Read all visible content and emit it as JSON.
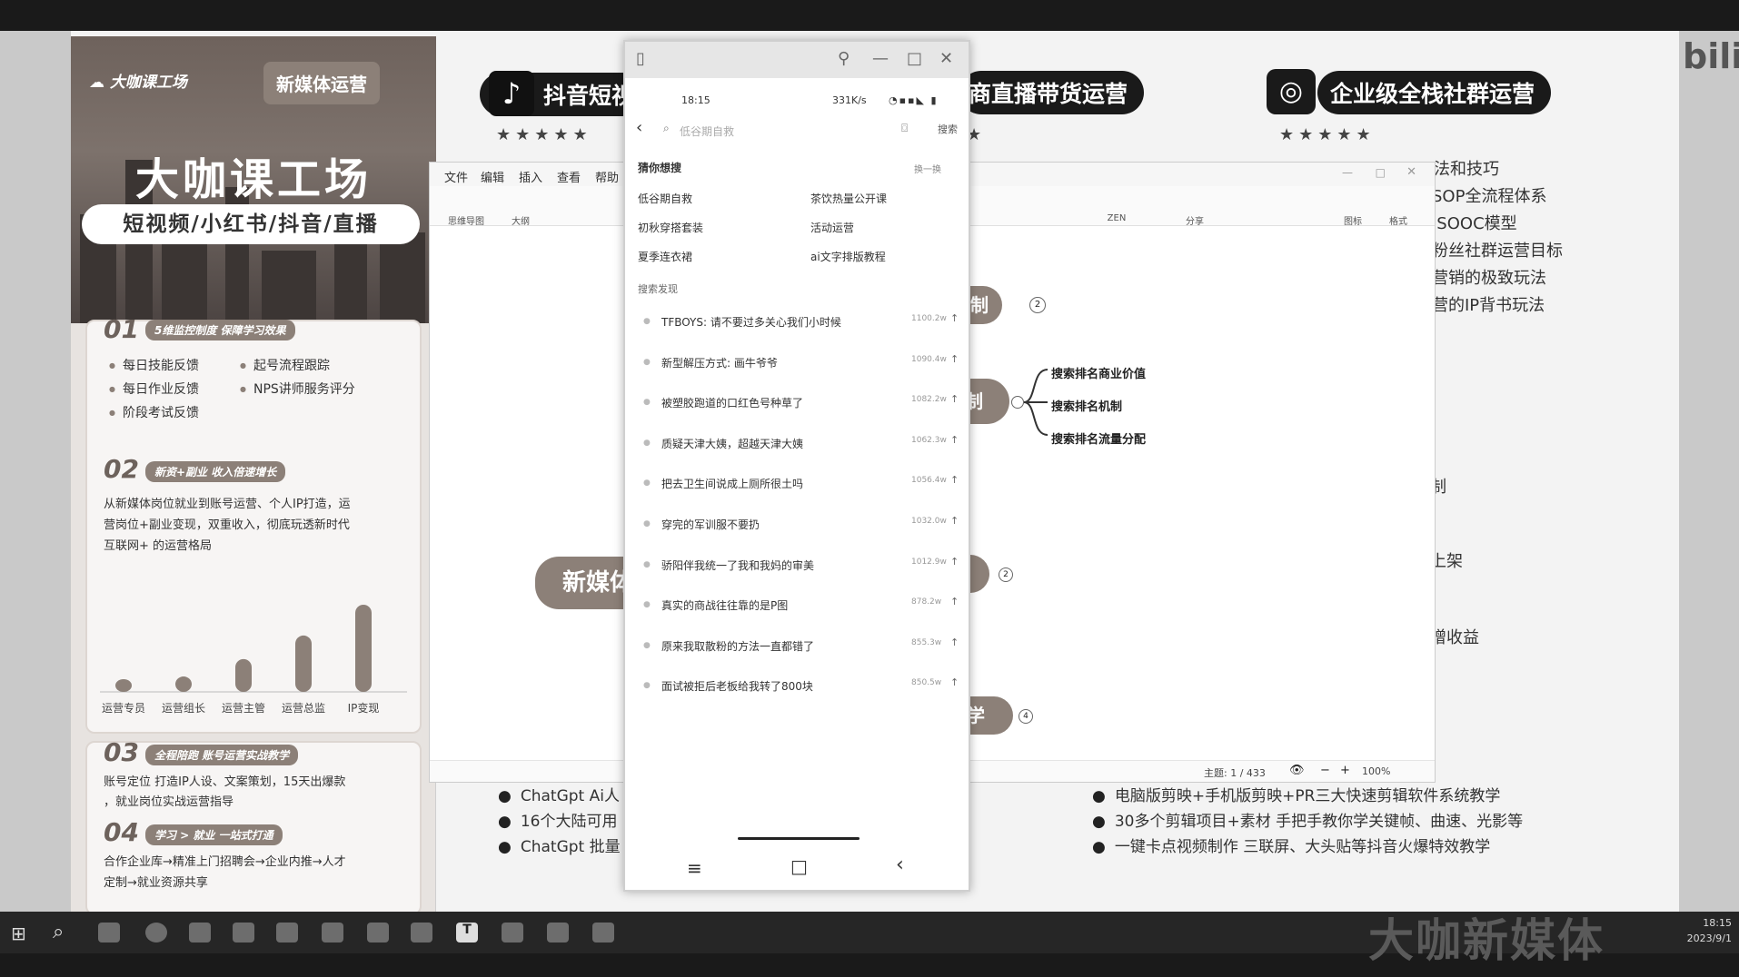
{
  "poster": {
    "logo": "大咖课工场",
    "tag": "新媒体运营",
    "title": "大咖课工场",
    "subtitle": "短视频/小红书/抖音/直播",
    "s1": {
      "num": "01",
      "tag": "5维监控制度 保障学习效果",
      "items": [
        "每日技能反馈",
        "起号流程跟踪",
        "每日作业反馈",
        "NPS讲师服务评分",
        "阶段考试反馈"
      ]
    },
    "s2": {
      "num": "02",
      "tag": "新资+副业 收入倍速增长",
      "text1": "从新媒体岗位就业到账号运营、个人IP打造，运",
      "text2": "营岗位+副业变现，双重收入，彻底玩透新时代",
      "text3": "互联网+ 的运营格局"
    },
    "chart_data": {
      "type": "bar",
      "categories": [
        "运营专员",
        "运营组长",
        "运营主管",
        "运营总监",
        "IP变现"
      ],
      "values": [
        1,
        1.5,
        3.2,
        5.5,
        8.5
      ]
    },
    "s3": {
      "num": "03",
      "tag": "全程陪跑 账号运营实战教学",
      "text1": "账号定位 打造IP人设、文案策划，15天出爆款",
      "text2": "，就业岗位实战运营指导"
    },
    "s4": {
      "num": "04",
      "tag": "学习 > 就业 一站式打通",
      "text1": "合作企业库→精准上门招聘会→企业内推→人才",
      "text2": "定制→就业资源共享"
    }
  },
  "bg": {
    "badge1": "抖音短视",
    "badge2": "商直播带货运营",
    "badge3": "企业级全栈社群运营",
    "stars": "★★★★★",
    "right_items": [
      "法和技巧",
      "SOP全流程体系",
      "ISOOC模型",
      "粉丝社群运营目标",
      "营销的极致玩法",
      "营的IP背书玩法"
    ],
    "frag1": "制",
    "frag2": "上架",
    "frag3": "增收益",
    "bottom_left": [
      "ChatGpt Ai人",
      "16个大陆可用",
      "ChatGpt 批量"
    ],
    "bottom_right": [
      "电脑版剪映+手机版剪映+PR三大快速剪辑软件系统教学",
      "30多个剪辑项目+素材 手把手教你学关键帧、曲速、光影等",
      "一键卡点视频制作 三联屏、大头贴等抖音火爆特效教学"
    ]
  },
  "mindmap": {
    "menu": [
      "文件",
      "编辑",
      "插入",
      "查看",
      "帮助"
    ],
    "tools_left": [
      "思维导图",
      "大纲"
    ],
    "tools_right": [
      "ZEN",
      "分享",
      "图标",
      "格式"
    ],
    "center": "新媒体",
    "node1": "机制",
    "node1_badge": "2",
    "node2": "制",
    "leaves": [
      "搜索排名商业价值",
      "搜索排名机制",
      "搜索排名流量分配"
    ],
    "node3_badge": "2",
    "node4": "学",
    "node4_badge": "4",
    "status": "主题: 1 / 433",
    "zoom": "100%"
  },
  "phone": {
    "time": "18:15",
    "net": "331K/s",
    "search_placeholder": "低谷期自救",
    "search_btn": "搜索",
    "guess_title": "猜你想搜",
    "refresh": "换一换",
    "suggest": [
      "低谷期自救",
      "茶饮热量公开课",
      "初秋穿搭套装",
      "活动运营",
      "夏季连衣裙",
      "ai文字排版教程"
    ],
    "hot_title": "搜索发现",
    "hot": [
      {
        "t": "TFBOYS: 请不要过多关心我们小时候",
        "c": "1100.2w"
      },
      {
        "t": "新型解压方式: 画牛爷爷",
        "c": "1090.4w"
      },
      {
        "t": "被塑胶跑道的口红色号种草了",
        "c": "1082.2w"
      },
      {
        "t": "质疑天津大姨，超越天津大姨",
        "c": "1062.3w"
      },
      {
        "t": "把去卫生间说成上厕所很土吗",
        "c": "1056.4w"
      },
      {
        "t": "穿完的军训服不要扔",
        "c": "1032.0w"
      },
      {
        "t": "骄阳伴我统一了我和我妈的审美",
        "c": "1012.9w"
      },
      {
        "t": "真实的商战往往靠的是P图",
        "c": "878.2w"
      },
      {
        "t": "原来我取散粉的方法一直都错了",
        "c": "855.3w"
      },
      {
        "t": "面试被拒后老板给我转了800块",
        "c": "850.5w"
      }
    ]
  },
  "taskbar": {
    "time": "18:15",
    "date": "2023/9/1",
    "watermark": "大咖新媒体",
    "corner": "bili"
  }
}
